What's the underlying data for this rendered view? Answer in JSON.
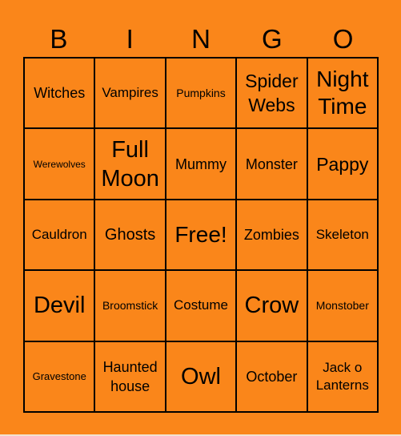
{
  "title_letters": [
    "B",
    "I",
    "N",
    "G",
    "O"
  ],
  "colors": {
    "background": "#fa861a",
    "grid_lines": "#000000",
    "text": "#000000"
  },
  "cells": [
    [
      "Witches",
      "Vampires",
      "Pumpkins",
      "Spider Webs",
      "Night Time"
    ],
    [
      "Werewolves",
      "Full Moon",
      "Mummy",
      "Monster",
      "Pappy"
    ],
    [
      "Cauldron",
      "Ghosts",
      "Free!",
      "Zombies",
      "Skeleton"
    ],
    [
      "Devil",
      "Broomstick",
      "Costume",
      "Crow",
      "Monstober"
    ],
    [
      "Gravestone",
      "Haunted house",
      "Owl",
      "October",
      "Jack o Lanterns"
    ]
  ]
}
